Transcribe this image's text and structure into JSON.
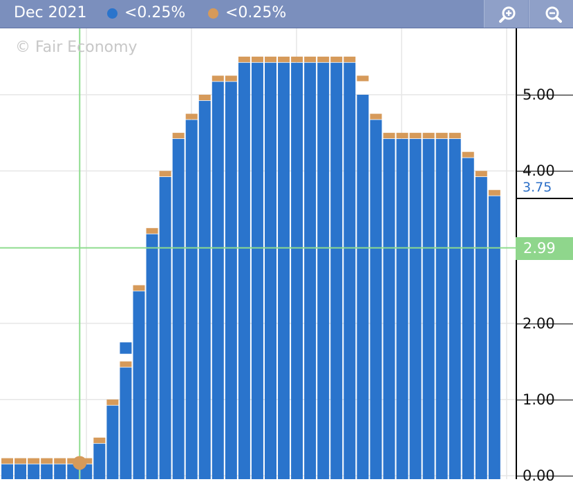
{
  "header": {
    "period": "Dec 2021",
    "legend": [
      {
        "label": "<0.25%",
        "color": "#2a74cc"
      },
      {
        "label": "<0.25%",
        "color": "#d69a5a"
      }
    ],
    "zoom_in_icon": "zoom-in-icon",
    "zoom_out_icon": "zoom-out-icon"
  },
  "watermark": "© Fair Economy",
  "colors": {
    "bar": "#2a74cc",
    "bar_cap": "#d69a5a",
    "crosshair": "#8edc8e",
    "grid": "#e6e6e6"
  },
  "chart_data": {
    "type": "bar",
    "y_tick_labels": [
      "0.00",
      "1.00",
      "2.00",
      "4.00",
      "5.00"
    ],
    "ylim": [
      0.0,
      5.85
    ],
    "grid": true,
    "series": [
      {
        "values": [
          0.15,
          0.15,
          0.15,
          0.15,
          0.15,
          0.15,
          0.15,
          0.42,
          0.92,
          1.42,
          2.42,
          3.17,
          3.92,
          4.42,
          4.67,
          4.92,
          5.17,
          5.17,
          5.42,
          5.42,
          5.42,
          5.42,
          5.42,
          5.42,
          5.42,
          5.42,
          5.42,
          5.0,
          4.67,
          4.42,
          4.42,
          4.42,
          4.42,
          4.42,
          4.42,
          4.17,
          3.92,
          3.67
        ]
      },
      {
        "values": [
          0.23,
          0.23,
          0.23,
          0.23,
          0.23,
          0.23,
          0.23,
          0.5,
          1.0,
          1.5,
          2.5,
          3.25,
          4.0,
          4.5,
          4.75,
          5.0,
          5.25,
          5.25,
          5.5,
          5.5,
          5.5,
          5.5,
          5.5,
          5.5,
          5.5,
          5.5,
          5.5,
          5.25,
          4.75,
          4.5,
          4.5,
          4.5,
          4.5,
          4.5,
          4.5,
          4.25,
          4.0,
          3.75
        ]
      }
    ],
    "special_bar": {
      "index": 9,
      "value": 1.75
    },
    "markers": {
      "last_value": "3.75",
      "crosshair_value": "2.99",
      "crosshair_y": 2.99,
      "crosshair_x_index": 5.5,
      "highlight_point": {
        "index": 5.5,
        "value": 0.25
      }
    }
  }
}
